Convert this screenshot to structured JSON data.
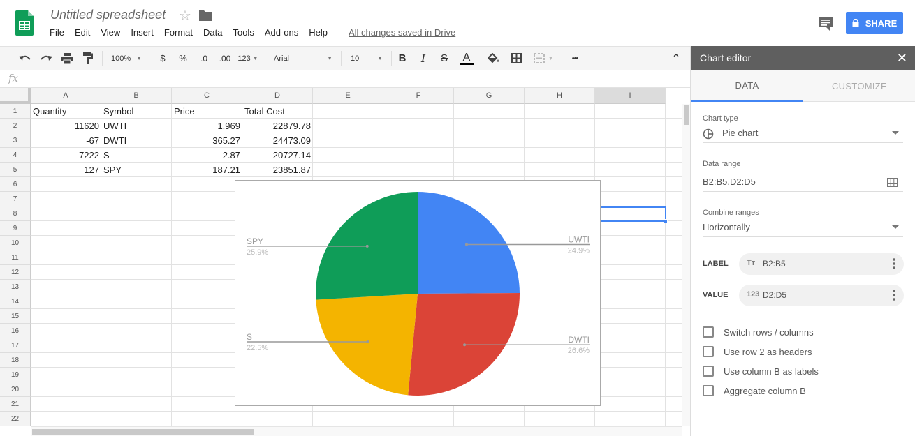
{
  "header": {
    "doc_title": "Untitled spreadsheet",
    "save_status": "All changes saved in Drive",
    "share_label": "SHARE",
    "menu": [
      "File",
      "Edit",
      "View",
      "Insert",
      "Format",
      "Data",
      "Tools",
      "Add-ons",
      "Help"
    ]
  },
  "toolbar": {
    "zoom": "100%",
    "currency": "$",
    "percent": "%",
    "decrease_decimals": ".0",
    "increase_decimals": ".00",
    "more_formats": "123",
    "font": "Arial",
    "font_size": "10",
    "bold": "B",
    "italic": "I",
    "strike": "S",
    "text_color": "A",
    "more": "•••",
    "collapse": "⌃"
  },
  "formula_bar": {
    "fx": "fx",
    "value": ""
  },
  "columns": [
    "A",
    "B",
    "C",
    "D",
    "E",
    "F",
    "G",
    "H",
    "I"
  ],
  "rows": [
    "1",
    "2",
    "3",
    "4",
    "5",
    "6",
    "7",
    "8",
    "9",
    "10",
    "11",
    "12",
    "13",
    "14",
    "15",
    "16",
    "17",
    "18",
    "19",
    "20",
    "21",
    "22"
  ],
  "sheet": {
    "headers": [
      "Quantity",
      "Symbol",
      "Price",
      "Total Cost"
    ],
    "data": [
      [
        "11620",
        "UWTI",
        "1.969",
        "22879.78"
      ],
      [
        "-67",
        "DWTI",
        "365.27",
        "24473.09"
      ],
      [
        "7222",
        "S",
        "2.87",
        "20727.14"
      ],
      [
        "127",
        "SPY",
        "187.21",
        "23851.87"
      ]
    ]
  },
  "chart_data": {
    "type": "pie",
    "categories": [
      "UWTI",
      "DWTI",
      "S",
      "SPY"
    ],
    "values": [
      22879.78,
      24473.09,
      20727.14,
      23851.87
    ],
    "percent_labels": [
      "24.9%",
      "26.6%",
      "22.5%",
      "25.9%"
    ],
    "colors": [
      "#4285f4",
      "#db4437",
      "#f4b400",
      "#0f9d58"
    ],
    "title": ""
  },
  "editor": {
    "title": "Chart editor",
    "close": "✕",
    "tabs": [
      "DATA",
      "CUSTOMIZE"
    ],
    "chart_type_label": "Chart type",
    "chart_type_value": "Pie chart",
    "data_range_label": "Data range",
    "data_range_value": "B2:B5,D2:D5",
    "combine_label": "Combine ranges",
    "combine_value": "Horizontally",
    "label_heading": "LABEL",
    "label_range": "B2:B5",
    "label_icon": "Tт",
    "value_heading": "VALUE",
    "value_range": "D2:D5",
    "value_icon": "123",
    "checkboxes": [
      "Switch rows / columns",
      "Use row 2 as headers",
      "Use column B as labels",
      "Aggregate column B"
    ]
  }
}
